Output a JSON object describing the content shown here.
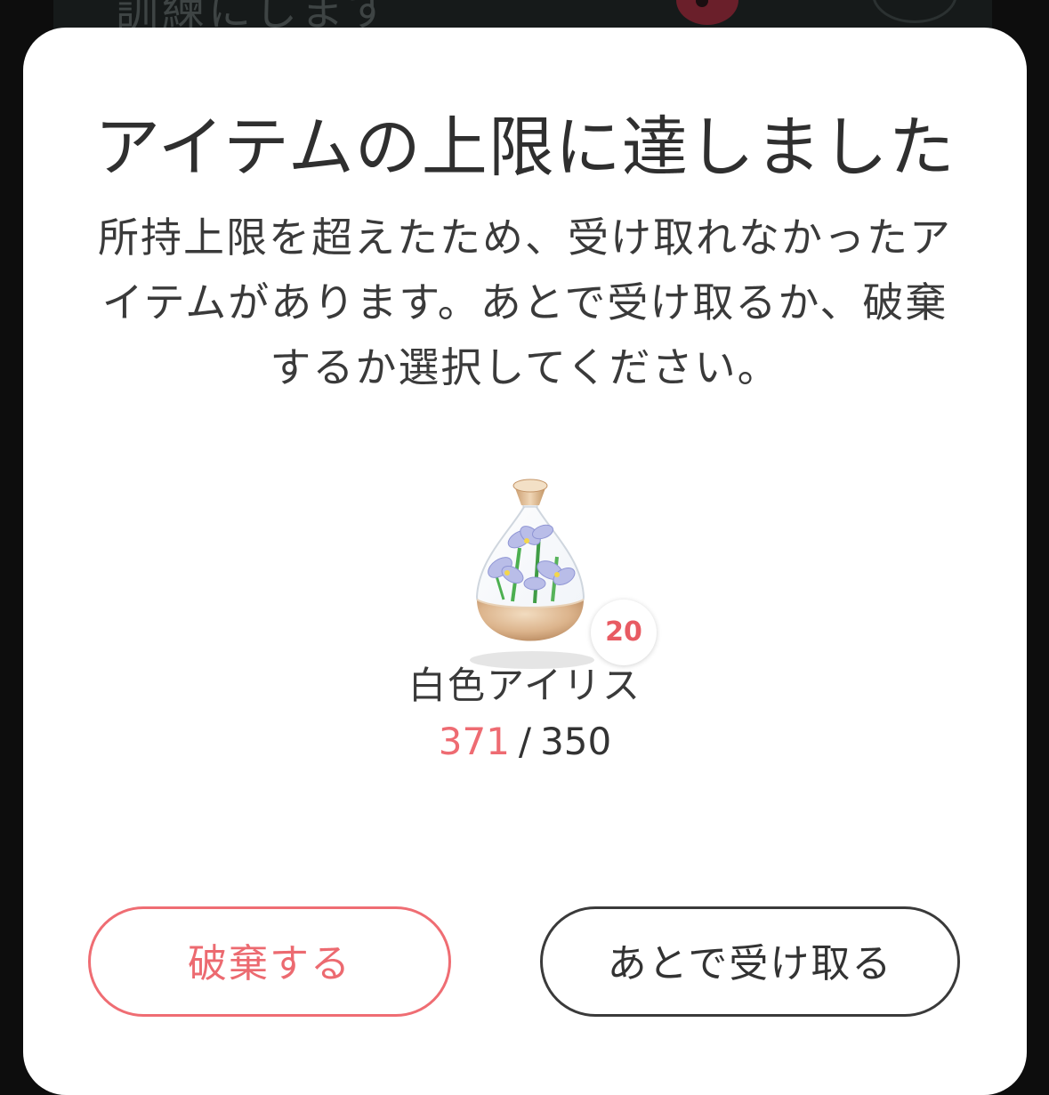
{
  "background": {
    "partial_text": "訓練にします"
  },
  "dialog": {
    "title": "アイテムの上限に達しました",
    "message": "所持上限を超えたため、受け取れなかったアイテムがあります。あとで受け取るか、破棄するか選択してください。"
  },
  "item": {
    "icon": "white-iris-bottle-icon",
    "badge_count": "20",
    "name": "白色アイリス",
    "current": "371",
    "separator": "/",
    "max": "350"
  },
  "buttons": {
    "discard_label": "破棄する",
    "later_label": "あとで受け取る"
  },
  "colors": {
    "accent_red": "#ee6b72",
    "text_dark": "#333333",
    "dialog_bg": "#ffffff",
    "backdrop": "#0d0d0d"
  }
}
